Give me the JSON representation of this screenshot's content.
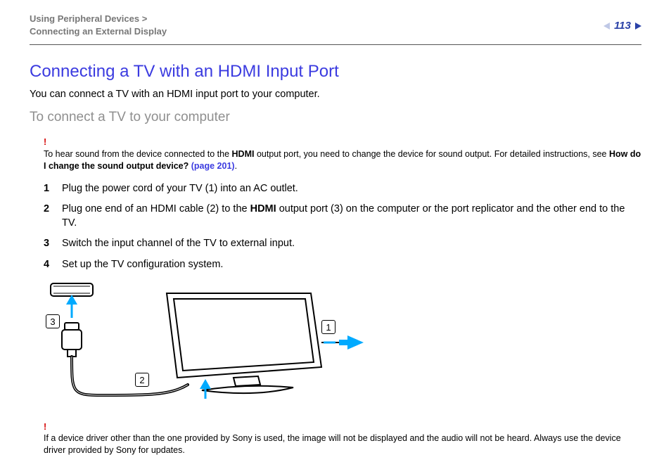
{
  "breadcrumb": {
    "line1": "Using Peripheral Devices",
    "chevron": ">",
    "line2": "Connecting an External Display"
  },
  "page_number": "113",
  "title": "Connecting a TV with an HDMI Input Port",
  "lead": "You can connect a TV with an HDMI input port to your computer.",
  "subheading": "To connect a TV to your computer",
  "note1": {
    "pre": "To hear sound from the device connected to the ",
    "bold1": "HDMI",
    "mid": " output port, you need to change the device for sound output. For detailed instructions, see ",
    "bold2": "How do I change the sound output device? ",
    "link": "(page 201)",
    "post": "."
  },
  "steps": [
    {
      "n": "1",
      "text": "Plug the power cord of your TV (1) into an AC outlet."
    },
    {
      "n": "2",
      "pre": "Plug one end of an HDMI cable (2) to the ",
      "bold": "HDMI",
      "post": " output port (3) on the computer or the port replicator and the other end to the TV."
    },
    {
      "n": "3",
      "text": "Switch the input channel of the TV to external input."
    },
    {
      "n": "4",
      "text": "Set up the TV configuration system."
    }
  ],
  "callouts": {
    "c1": "1",
    "c2": "2",
    "c3": "3"
  },
  "note2": "If a device driver other than the one provided by Sony is used, the image will not be displayed and the audio will not be heard. Always use the device driver provided by Sony for updates."
}
